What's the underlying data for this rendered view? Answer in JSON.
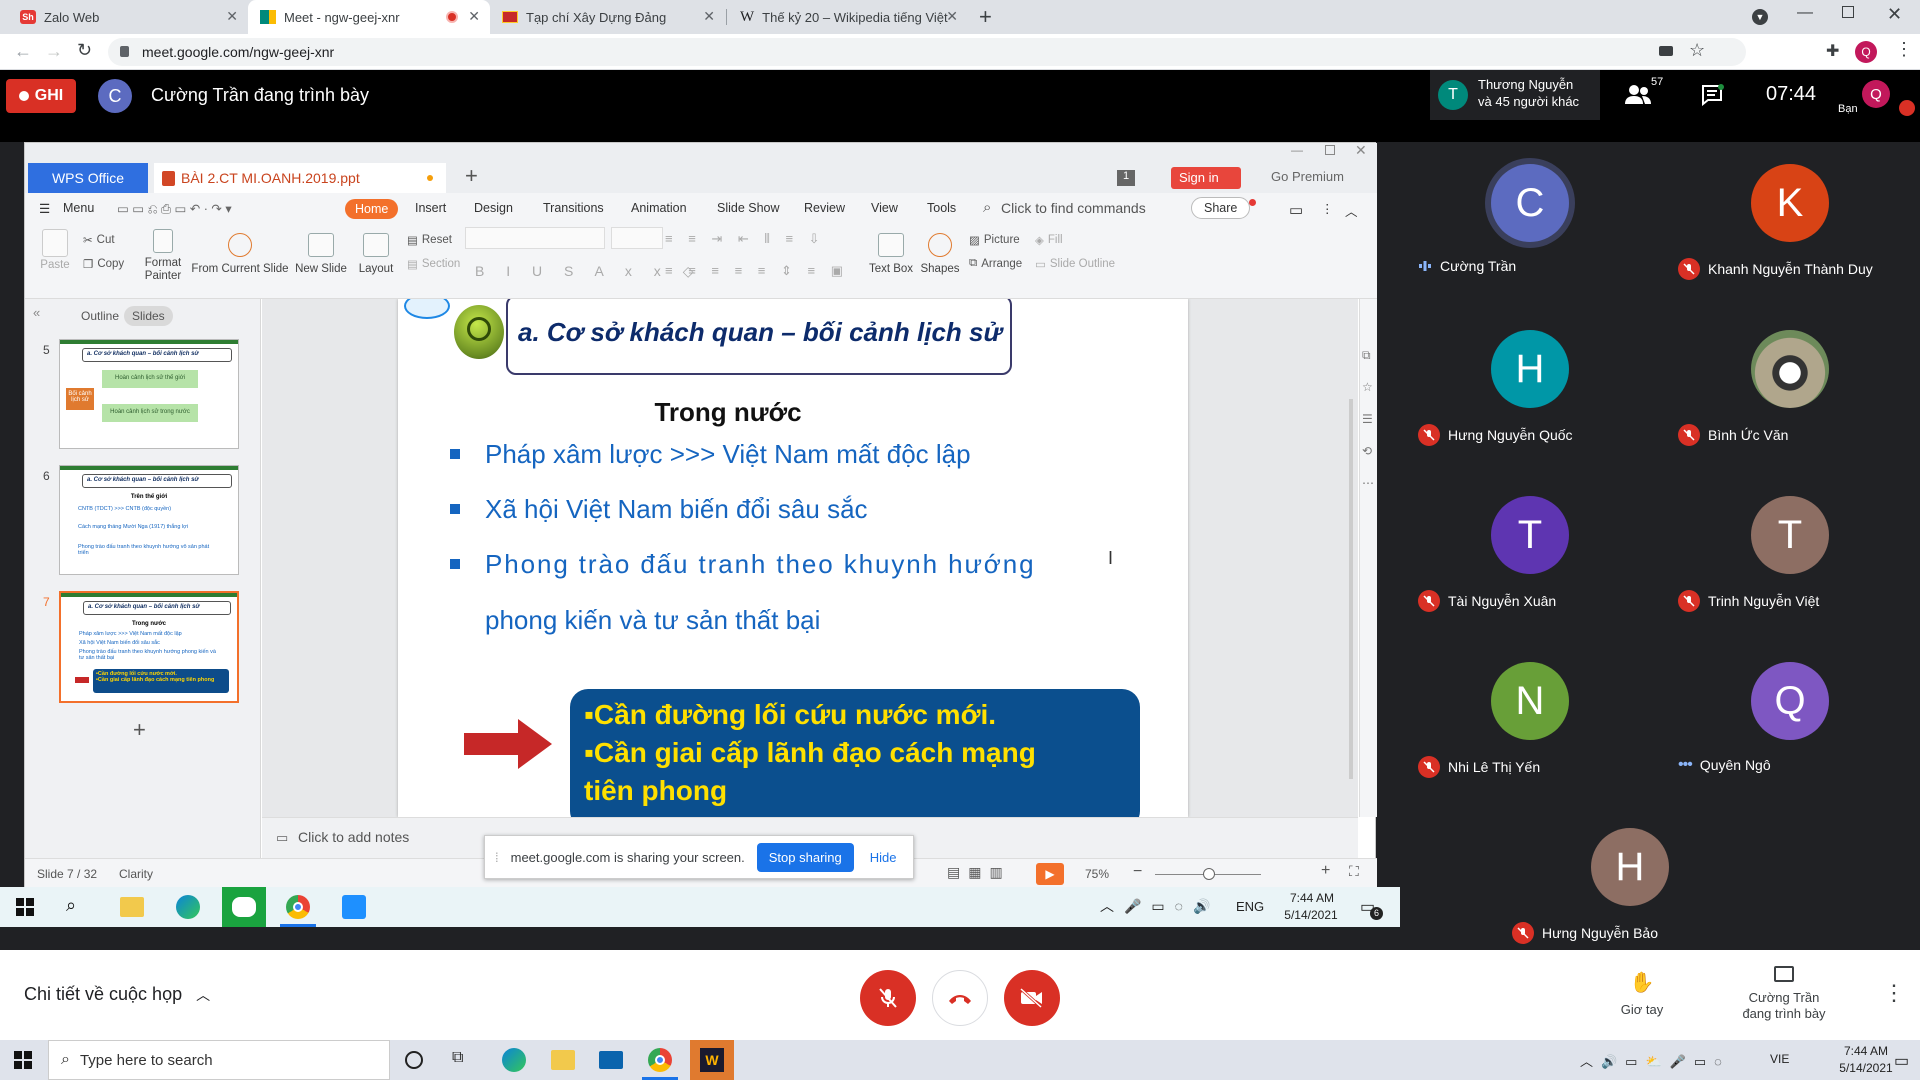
{
  "browser": {
    "tabs": [
      {
        "title": "Zalo Web"
      },
      {
        "title": "Meet - ngw-geej-xnr"
      },
      {
        "title": "Tạp chí Xây Dựng Đảng"
      },
      {
        "title": "Thế kỷ 20 – Wikipedia tiếng Việt"
      }
    ],
    "url": "meet.google.com/ngw-geej-xnr",
    "profile_initial": "Q"
  },
  "meet": {
    "record_label": "GHI",
    "presenter_initial": "C",
    "presenter_text": "Cường Trần đang trình bày",
    "others_initial": "T",
    "others_line1": "Thương Nguyễn",
    "others_line2": "và 45 người khác",
    "people_count": "57",
    "time": "07:44",
    "me_label": "Bạn",
    "me_initial": "Q",
    "meeting_details": "Chi tiết về cuộc họp",
    "raise_hand": "Giơ tay",
    "presenting_line1": "Cường Trần",
    "presenting_line2": "đang trình bày",
    "colors": {
      "red": "#d93025",
      "bg": "#202124"
    }
  },
  "participants": [
    {
      "initial": "C",
      "name": "Cường Trần",
      "color": "#5c6bc0",
      "state": "speaking"
    },
    {
      "initial": "K",
      "name": "Khanh Nguyễn Thành Duy",
      "color": "#d84315",
      "state": "muted"
    },
    {
      "initial": "H",
      "name": "Hưng Nguyễn Quốc",
      "color": "#0097a7",
      "state": "muted"
    },
    {
      "initial": "",
      "name": "Bình Ức Văn",
      "color": "#8d9a86",
      "state": "muted"
    },
    {
      "initial": "T",
      "name": "Tài Nguyễn Xuân",
      "color": "#5e35b1",
      "state": "muted"
    },
    {
      "initial": "T",
      "name": "Trinh Nguyễn Việt",
      "color": "#8d6e63",
      "state": "muted"
    },
    {
      "initial": "N",
      "name": "Nhi Lê Thị Yến",
      "color": "#689f38",
      "state": "muted"
    },
    {
      "initial": "Q",
      "name": "Quyên Ngô",
      "color": "#7e57c2",
      "state": "more"
    },
    {
      "initial": "H",
      "name": "Hưng Nguyễn Bảo",
      "color": "#8d6e63",
      "state": "muted"
    }
  ],
  "wps": {
    "app_tab": "WPS Office",
    "doc_tab": "BÀI 2.CT MI.OANH.2019.ppt",
    "window_count": "1",
    "sign_in": "Sign in",
    "go_premium": "Go Premium",
    "menu": [
      "Menu",
      "Home",
      "Insert",
      "Design",
      "Transitions",
      "Animation",
      "Slide Show",
      "Review",
      "View",
      "Tools"
    ],
    "find_commands": "Click to find commands",
    "share": "Share",
    "ribbon": {
      "paste": "Paste",
      "cut": "Cut",
      "copy": "Copy",
      "format_painter_1": "Format",
      "format_painter_2": "Painter",
      "from_current_slide": "From Current Slide",
      "new_slide": "New Slide",
      "layout": "Layout",
      "reset": "Reset",
      "section": "Section",
      "text_box": "Text Box",
      "shapes": "Shapes",
      "picture": "Picture",
      "fill": "Fill",
      "arrange": "Arrange",
      "slide_outline": "Slide Outline"
    },
    "panel_tabs": [
      "Outline",
      "Slides"
    ],
    "thumbs": [
      {
        "num": "5",
        "title": "a.  Cơ sở khách quan – bối cảnh lịch sử",
        "center": "Bối cảnh lịch sử",
        "b1": "Hoàn cảnh lịch sử thế giới",
        "b2": "Hoàn cảnh lịch sử trong nước"
      },
      {
        "num": "6",
        "title": "a.  Cơ sở khách quan – bối cảnh lịch sử",
        "heading": "Trên thế giới",
        "items": [
          "CNTB (TDCT) >>> CNTB (độc quyền)",
          "Cách mạng tháng Mười Nga (1917) thắng lợi",
          "Phong trào đấu tranh theo khuynh hướng vô sản phát triển"
        ]
      },
      {
        "num": "7",
        "title": "a.  Cơ sở khách quan – bối cảnh lịch sử",
        "heading": "Trong nước",
        "items": [
          "Pháp xâm lược >>> Việt Nam mất độc lập",
          "Xã hội Việt Nam biến đổi sâu sắc",
          "Phong trào đấu tranh theo khuynh hướng phong kiến và tư sản thất bại"
        ],
        "box": [
          "•Cần đường lối cứu nước mới.",
          "•Cần giai cấp lãnh đạo cách mạng tiên phong"
        ]
      }
    ],
    "slide": {
      "title": "a.  Cơ sở khách quan – bối cảnh lịch sử",
      "heading": "Trong nước",
      "bullets": [
        "Pháp xâm lược >>> Việt Nam mất độc lập",
        "Xã hội Việt Nam biến đổi sâu sắc",
        "Phong trào đấu tranh theo khuynh hướng",
        "phong kiến và tư sản thất bại"
      ],
      "box_line1": "▪Cần đường lối cứu nước mới.",
      "box_line2": "▪Cần giai cấp lãnh đạo cách mạng",
      "box_line3": "tiên phong"
    },
    "notes_placeholder": "Click to add notes",
    "status_slide": "Slide 7 / 32",
    "status_theme": "Clarity",
    "zoom": "75%"
  },
  "share_bar": {
    "text": "meet.google.com is sharing your screen.",
    "stop": "Stop sharing",
    "hide": "Hide"
  },
  "inner_taskbar": {
    "lang": "ENG",
    "time": "7:44 AM",
    "date": "5/14/2021",
    "notif": "6"
  },
  "win_taskbar": {
    "search_placeholder": "Type here to search",
    "lang": "VIE",
    "time": "7:44 AM",
    "date": "5/14/2021"
  }
}
